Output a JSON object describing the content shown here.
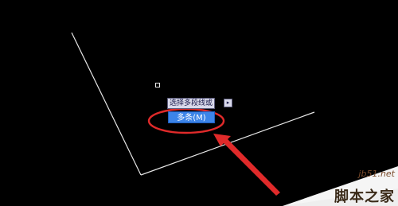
{
  "canvas": {
    "background": "#000000",
    "line_color": "#e6e6e6"
  },
  "cursor": {
    "icon": "pickbox-icon"
  },
  "prompt": {
    "text": "选择多段线或",
    "expand_icon": "▸"
  },
  "option": {
    "label": "多条(M)",
    "color": "#3c84e8"
  },
  "annotation": {
    "ellipse_color": "#e02a2a",
    "arrow_color": "#e02a2a"
  },
  "watermark": {
    "url": "jb51.net",
    "name": "脚本之家"
  }
}
